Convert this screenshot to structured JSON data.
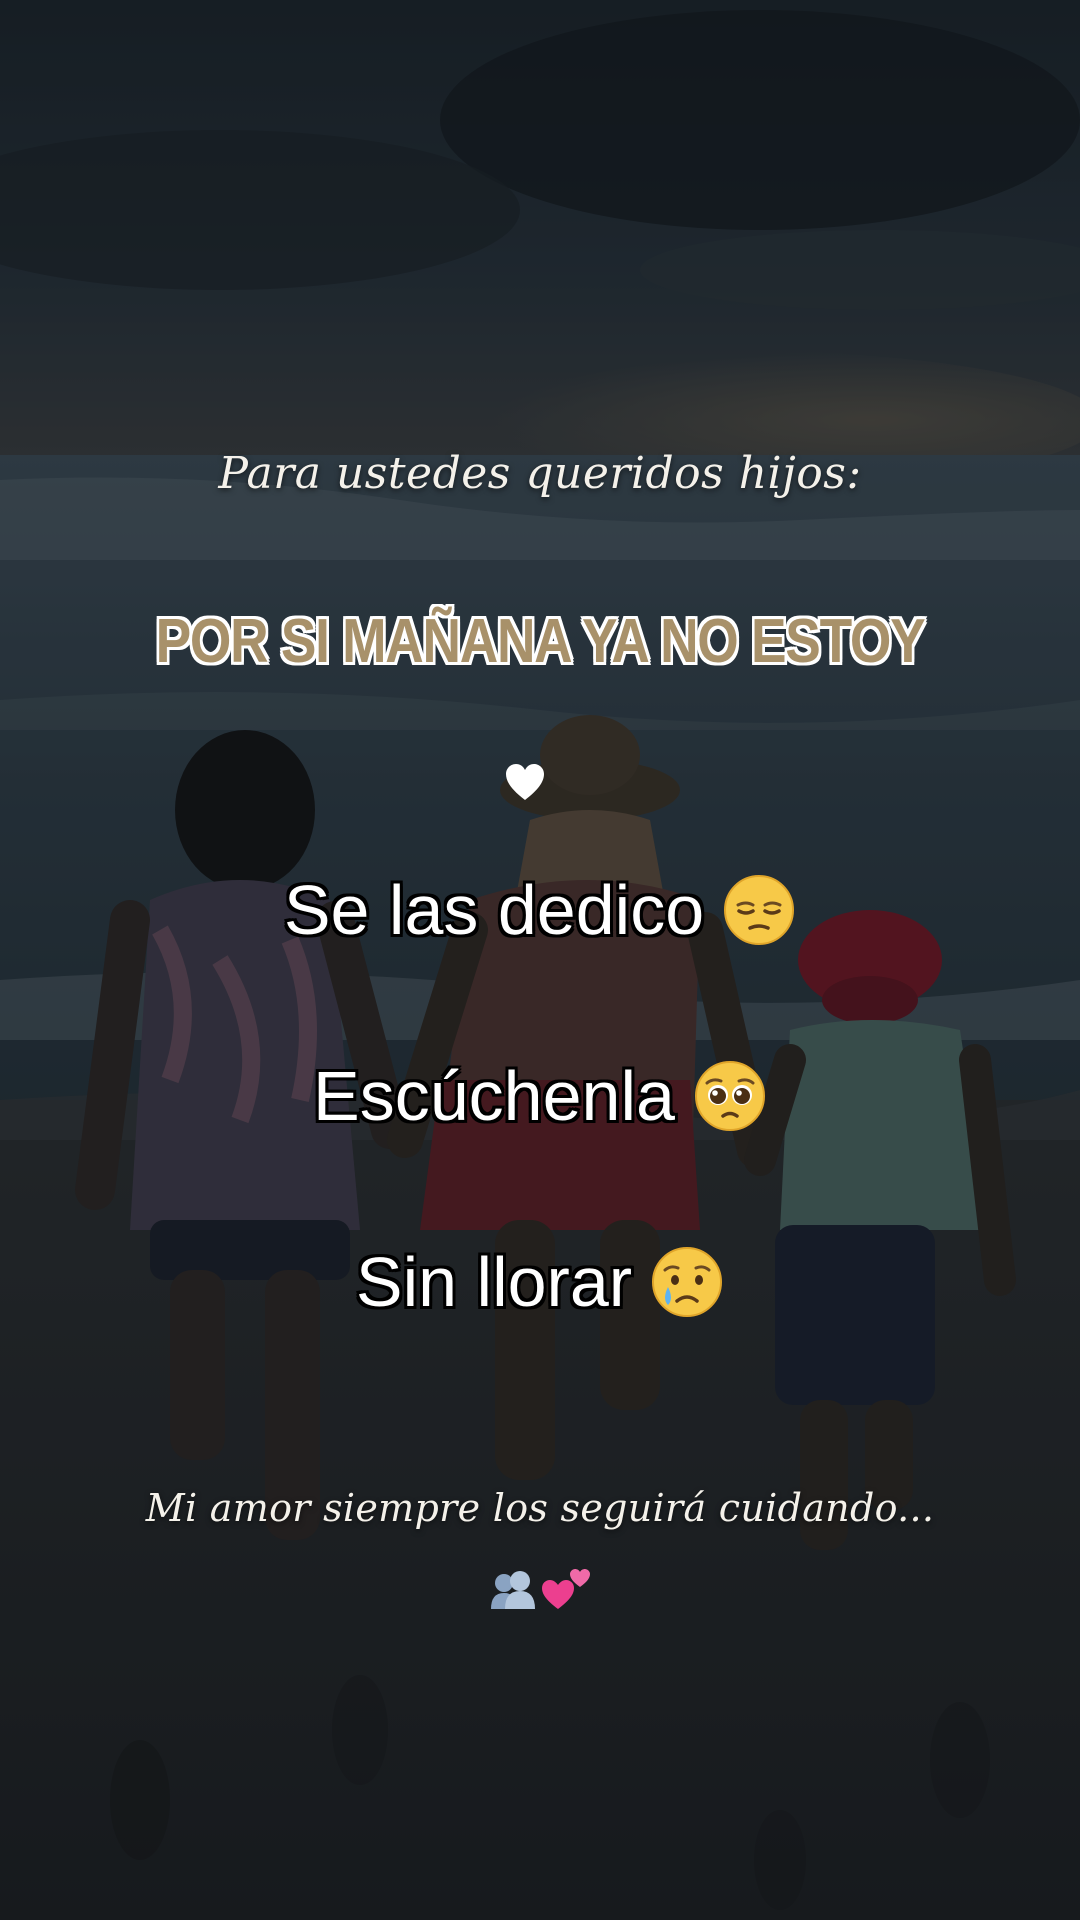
{
  "intro_text": "Para ustedes  queridos hijos:",
  "headline": "POR SI MAÑANA YA NO ESTOY",
  "lines": [
    {
      "text": "Se las dedico",
      "emoji": "pensive-face-icon"
    },
    {
      "text": "Escúchenla",
      "emoji": "pleading-face-icon"
    },
    {
      "text": "Sin llorar",
      "emoji": "crying-face-icon"
    }
  ],
  "outro_text": "Mi amor siempre  los seguirá cuidando...",
  "trailing_emojis": [
    "busts-in-silhouette-icon",
    "two-hearts-icon"
  ],
  "colors": {
    "headline_fill": "#a8916a",
    "headline_outline": "#ffffff",
    "body_text": "#ffffff",
    "body_outline": "#000000"
  }
}
